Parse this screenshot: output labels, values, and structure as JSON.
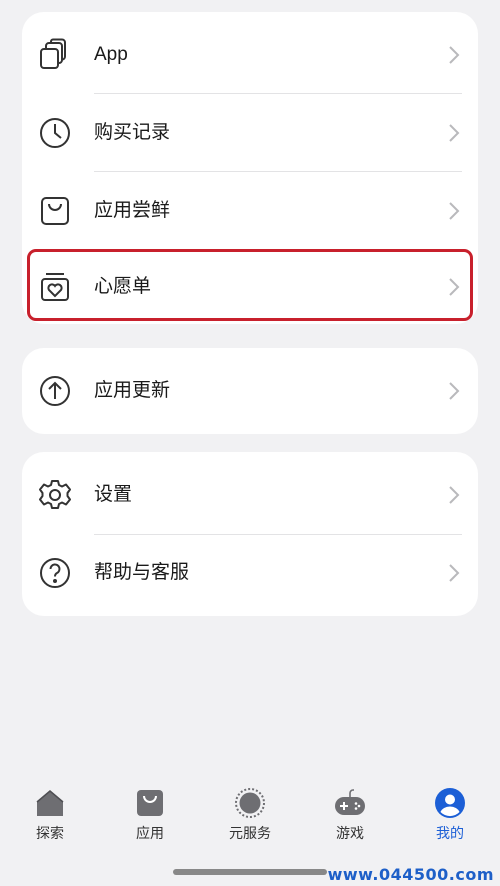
{
  "menu_group_1": {
    "items": [
      {
        "label": "App"
      },
      {
        "label": "购买记录"
      },
      {
        "label": "应用尝鲜"
      },
      {
        "label": "心愿单"
      }
    ]
  },
  "menu_group_2": {
    "items": [
      {
        "label": "应用更新"
      }
    ]
  },
  "menu_group_3": {
    "items": [
      {
        "label": "设置"
      },
      {
        "label": "帮助与客服"
      }
    ]
  },
  "tabbar": {
    "tabs": [
      {
        "label": "探索",
        "icon": "home-icon"
      },
      {
        "label": "应用",
        "icon": "shopping-bag-icon"
      },
      {
        "label": "元服务",
        "icon": "atomic-service-icon"
      },
      {
        "label": "游戏",
        "icon": "gamepad-icon"
      },
      {
        "label": "我的",
        "icon": "profile-icon",
        "active": true
      }
    ]
  },
  "watermark": "www.044500.com",
  "colors": {
    "accent": "#1c5fd6",
    "highlight_border": "#c8202c",
    "background": "#f1f1f3"
  }
}
